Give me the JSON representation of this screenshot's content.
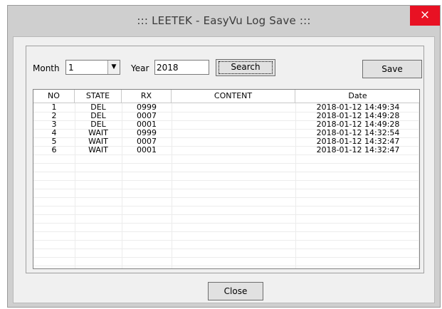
{
  "window": {
    "title": "::: LEETEK - EasyVu Log Save :::",
    "close_glyph": "×"
  },
  "filters": {
    "month_label": "Month",
    "month_value": "1",
    "year_label": "Year",
    "year_value": "2018",
    "search_label": "Search",
    "save_label": "Save"
  },
  "table": {
    "columns": [
      "NO",
      "STATE",
      "RX",
      "CONTENT",
      "Date"
    ],
    "rows": [
      [
        "1",
        "DEL",
        "0999",
        "",
        "2018-01-12 14:49:34"
      ],
      [
        "2",
        "DEL",
        "0007",
        "",
        "2018-01-12 14:49:28"
      ],
      [
        "3",
        "DEL",
        "0001",
        "",
        "2018-01-12 14:49:28"
      ],
      [
        "4",
        "WAIT",
        "0999",
        "",
        "2018-01-12 14:32:54"
      ],
      [
        "5",
        "WAIT",
        "0007",
        "",
        "2018-01-12 14:32:47"
      ],
      [
        "6",
        "WAIT",
        "0001",
        "",
        "2018-01-12 14:32:47"
      ]
    ]
  },
  "footer": {
    "close_label": "Close"
  },
  "colors": {
    "close_button_bg": "#e81123",
    "dialog_bg": "#f0f0f0",
    "frame_bg": "#cfcfcf"
  }
}
